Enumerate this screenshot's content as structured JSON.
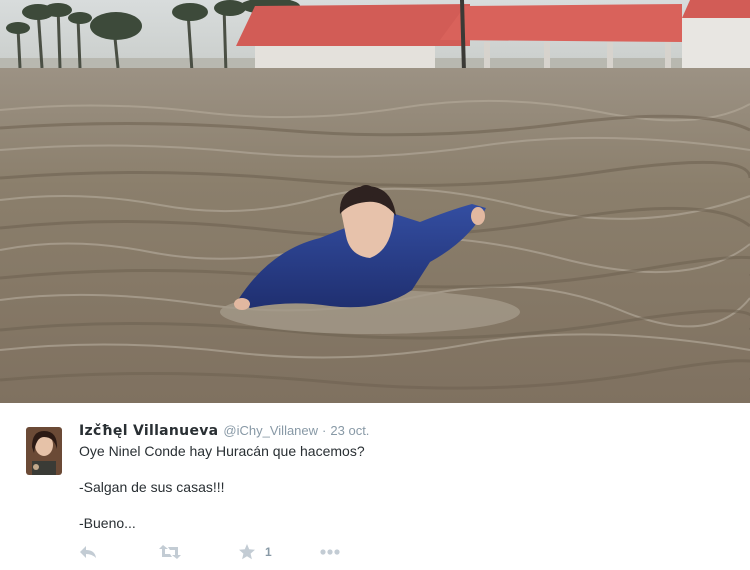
{
  "photo": {
    "subject": "person-in-floodwater"
  },
  "tweet": {
    "display_name": "Izčħęl Villanueva",
    "handle": "@iChy_Villanew",
    "separator": "·",
    "date": "23 oct.",
    "lines": [
      "Oye Ninel Conde hay Huracán que hacemos?",
      "-Salgan de sus casas!!!",
      "-Bueno..."
    ],
    "actions": {
      "reply_icon": "reply-icon",
      "retweet_icon": "retweet-icon",
      "favorite_icon": "star-icon",
      "favorite_count": "1",
      "more_icon": "more-icon"
    }
  },
  "colors": {
    "text": "#292f33",
    "muted": "#8899a6",
    "icon": "#c3ccd4",
    "water": "#8a7c68",
    "roof": "#d9605a",
    "jacket": "#2a3f8c"
  }
}
